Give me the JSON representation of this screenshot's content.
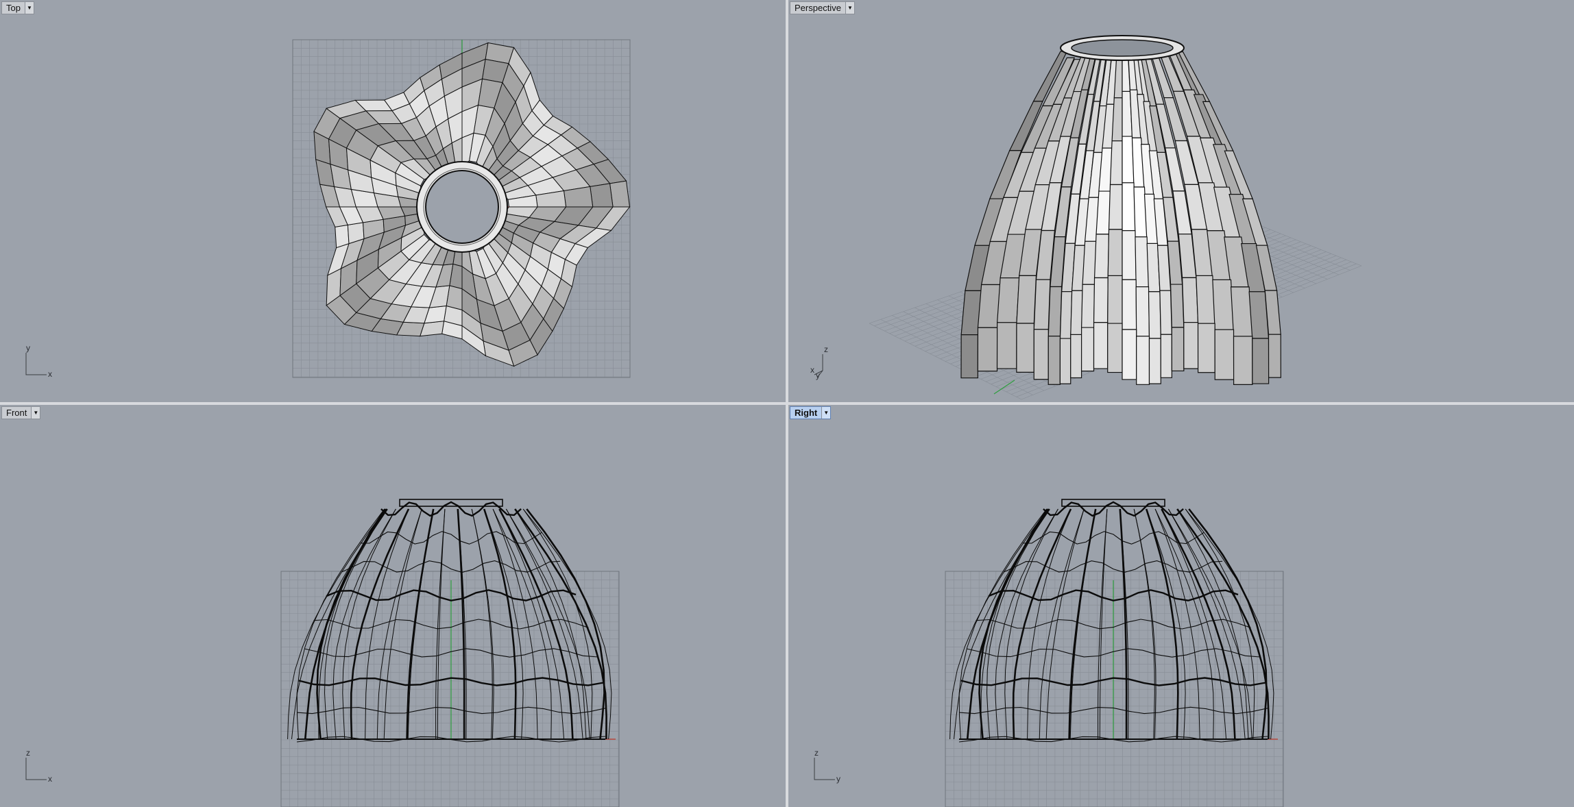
{
  "viewports": {
    "top": {
      "label": "Top",
      "axis_v": "y",
      "axis_h": "x",
      "active": false
    },
    "persp": {
      "label": "Perspective",
      "axis_v": "z",
      "axis_h": "x",
      "axis_d": "y",
      "active": false
    },
    "front": {
      "label": "Front",
      "axis_v": "z",
      "axis_h": "x",
      "active": false
    },
    "right": {
      "label": "Right",
      "axis_v": "z",
      "axis_h": "y",
      "active": true
    }
  },
  "icons": {
    "dropdown": "chevron-down-icon"
  },
  "colors": {
    "viewport_bg": "#9ca2ab",
    "grid_line": "#878d96",
    "x_axis": "#c0392b",
    "y_axis": "#2e9e3f",
    "active_tab": "#b8d0f0"
  }
}
